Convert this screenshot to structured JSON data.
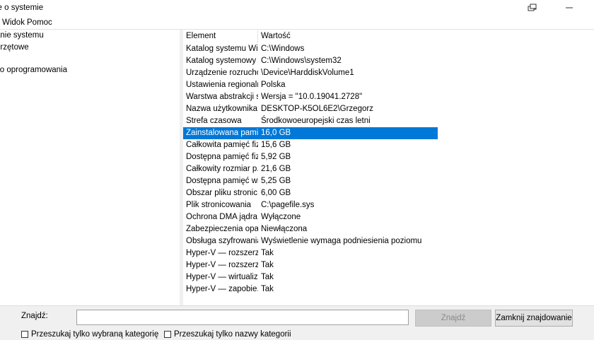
{
  "window": {
    "title": "je o systemie"
  },
  "menu": {
    "items": [
      "Widok",
      "Pomoc"
    ]
  },
  "tree": {
    "items": [
      "anie systemu",
      "przętowe",
      "ko oprogramowania"
    ]
  },
  "list": {
    "header": {
      "element": "Element",
      "value": "Wartość"
    },
    "rows": [
      {
        "element": "Katalog systemu Wi...",
        "value": "C:\\Windows"
      },
      {
        "element": "Katalog systemowy",
        "value": "C:\\Windows\\system32"
      },
      {
        "element": "Urządzenie rozruchowe",
        "value": "\\Device\\HarddiskVolume1"
      },
      {
        "element": "Ustawienia regionalne",
        "value": "Polska"
      },
      {
        "element": "Warstwa abstrakcji s...",
        "value": "Wersja = \"10.0.19041.2728\""
      },
      {
        "element": "Nazwa użytkownika",
        "value": "DESKTOP-K5OL6E2\\Grzegorz"
      },
      {
        "element": "Strefa czasowa",
        "value": "Środkowoeuropejski czas letni"
      },
      {
        "element": "Zainstalowana pami...",
        "value": "16,0 GB",
        "selected": true
      },
      {
        "element": "Całkowita pamięć fiz...",
        "value": "15,6 GB"
      },
      {
        "element": "Dostępna pamięć fiz...",
        "value": "5,92 GB"
      },
      {
        "element": "Całkowity rozmiar p...",
        "value": "21,6 GB"
      },
      {
        "element": "Dostępna pamięć wi...",
        "value": "5,25 GB"
      },
      {
        "element": "Obszar pliku stronic...",
        "value": "6,00 GB"
      },
      {
        "element": "Plik stronicowania",
        "value": "C:\\pagefile.sys"
      },
      {
        "element": "Ochrona DMA jądra",
        "value": "Wyłączone"
      },
      {
        "element": "Zabezpieczenia opar...",
        "value": "Niewłączona"
      },
      {
        "element": "Obsługa szyfrowania...",
        "value": "Wyświetlenie wymaga podniesienia poziomu"
      },
      {
        "element": "Hyper-V — rozszerz...",
        "value": "Tak"
      },
      {
        "element": "Hyper-V — rozszerz...",
        "value": "Tak"
      },
      {
        "element": "Hyper-V — wirtualiz...",
        "value": "Tak"
      },
      {
        "element": "Hyper-V — zapobie...",
        "value": "Tak"
      }
    ]
  },
  "find": {
    "label": "Znajdź:",
    "value": "",
    "find_button": "Znajdź",
    "close_button": "Zamknij znajdowanie",
    "check1": "Przeszukaj tylko wybraną kategorię",
    "check2": "Przeszukaj tylko nazwy kategorii"
  },
  "colors": {
    "selection": "#0078d7",
    "bottom_bar": "#f0f0f0"
  },
  "icons": [
    "restore-icon",
    "minimize-icon"
  ]
}
